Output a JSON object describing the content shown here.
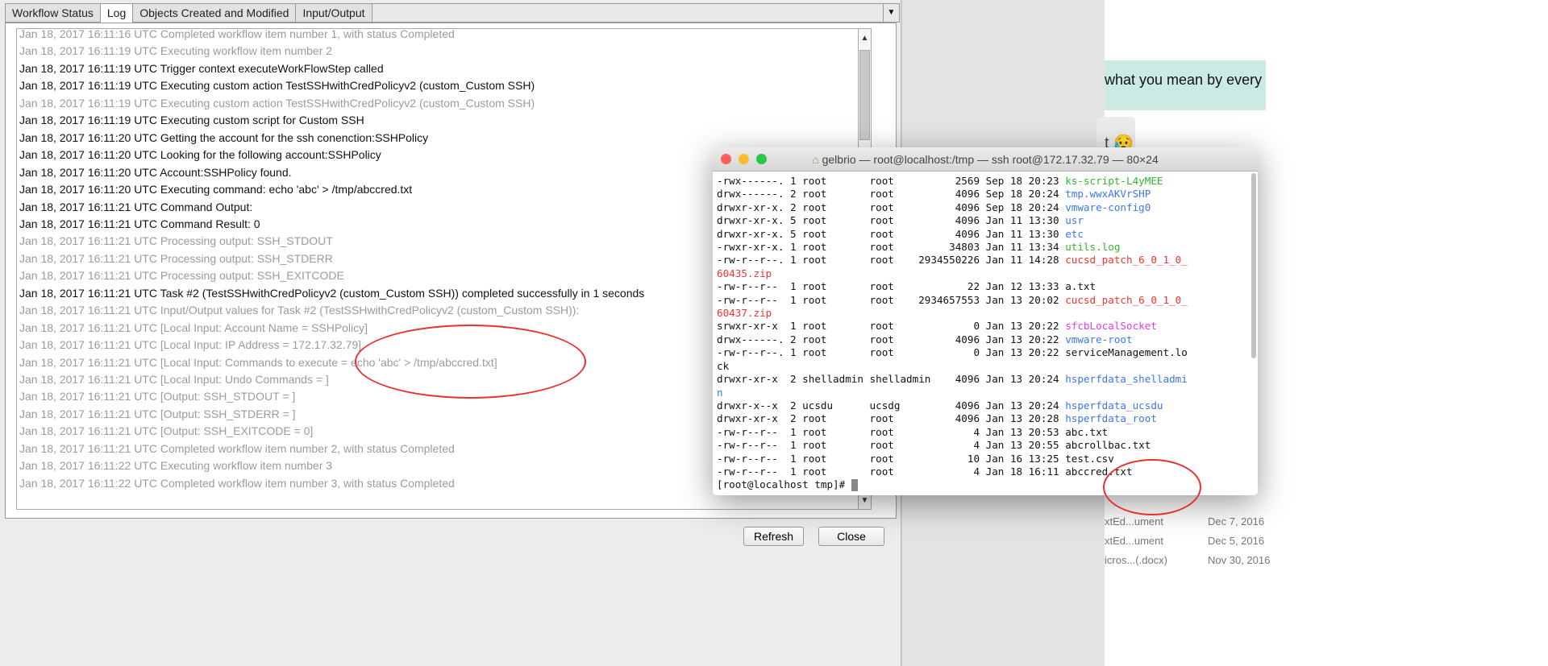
{
  "dialog": {
    "tabs": [
      {
        "label": "Workflow Status",
        "active": false
      },
      {
        "label": "Log",
        "active": true
      },
      {
        "label": "Objects Created and Modified",
        "active": false
      },
      {
        "label": "Input/Output",
        "active": false
      }
    ],
    "log": [
      {
        "text": "Jan 18, 2017 16:11:16 UTC Completed workflow item number 1, with status Completed",
        "style": "gray"
      },
      {
        "text": "Jan 18, 2017 16:11:19 UTC Executing workflow item number 2",
        "style": "gray"
      },
      {
        "text": "Jan 18, 2017 16:11:19 UTC Trigger context executeWorkFlowStep called",
        "style": "black"
      },
      {
        "text": "Jan 18, 2017 16:11:19 UTC Executing custom action TestSSHwithCredPolicyv2 (custom_Custom SSH)",
        "style": "black"
      },
      {
        "text": "Jan 18, 2017 16:11:19 UTC Executing custom action TestSSHwithCredPolicyv2 (custom_Custom SSH)",
        "style": "gray"
      },
      {
        "text": "Jan 18, 2017 16:11:19 UTC Executing custom script for Custom SSH",
        "style": "black"
      },
      {
        "text": "Jan 18, 2017 16:11:20 UTC Getting the account for the ssh conenction:SSHPolicy",
        "style": "black"
      },
      {
        "text": "Jan 18, 2017 16:11:20 UTC Looking for the following account:SSHPolicy",
        "style": "black"
      },
      {
        "text": "Jan 18, 2017 16:11:20 UTC Account:SSHPolicy found.",
        "style": "black"
      },
      {
        "text": "Jan 18, 2017 16:11:20 UTC Executing command: echo 'abc' > /tmp/abccred.txt",
        "style": "black"
      },
      {
        "text": "Jan 18, 2017 16:11:21 UTC Command Output:",
        "style": "black"
      },
      {
        "text": "Jan 18, 2017 16:11:21 UTC Command Result: 0",
        "style": "black"
      },
      {
        "text": "Jan 18, 2017 16:11:21 UTC Processing output: SSH_STDOUT",
        "style": "gray"
      },
      {
        "text": "Jan 18, 2017 16:11:21 UTC Processing output: SSH_STDERR",
        "style": "gray"
      },
      {
        "text": "Jan 18, 2017 16:11:21 UTC Processing output: SSH_EXITCODE",
        "style": "gray"
      },
      {
        "text": "Jan 18, 2017 16:11:21 UTC Task #2 (TestSSHwithCredPolicyv2 (custom_Custom SSH)) completed successfully in 1 seconds",
        "style": "black"
      },
      {
        "text": "Jan 18, 2017 16:11:21 UTC Input/Output values for Task #2 (TestSSHwithCredPolicyv2 (custom_Custom SSH)):",
        "style": "gray"
      },
      {
        "text": "Jan 18, 2017 16:11:21 UTC [Local Input: Account Name = SSHPolicy]",
        "style": "gray"
      },
      {
        "text": "Jan 18, 2017 16:11:21 UTC [Local Input: IP Address = 172.17.32.79]",
        "style": "gray"
      },
      {
        "text": "Jan 18, 2017 16:11:21 UTC [Local Input: Commands to execute = echo 'abc' > /tmp/abccred.txt]",
        "style": "gray"
      },
      {
        "text": "Jan 18, 2017 16:11:21 UTC [Local Input: Undo Commands = ]",
        "style": "gray"
      },
      {
        "text": "Jan 18, 2017 16:11:21 UTC [Output: SSH_STDOUT = ]",
        "style": "gray"
      },
      {
        "text": "Jan 18, 2017 16:11:21 UTC [Output: SSH_STDERR = ]",
        "style": "gray"
      },
      {
        "text": "Jan 18, 2017 16:11:21 UTC [Output: SSH_EXITCODE = 0]",
        "style": "gray"
      },
      {
        "text": "Jan 18, 2017 16:11:21 UTC Completed workflow item number 2, with status Completed",
        "style": "gray"
      },
      {
        "text": "Jan 18, 2017 16:11:22 UTC Executing workflow item number 3",
        "style": "gray"
      },
      {
        "text": "Jan 18, 2017 16:11:22 UTC Completed workflow item number 3, with status Completed",
        "style": "gray"
      }
    ],
    "refresh_label": "Refresh",
    "close_label": "Close"
  },
  "terminal": {
    "title": "gelbrio — root@localhost:/tmp — ssh root@172.17.32.79 — 80×24",
    "lines": [
      {
        "text": "-rwx------. 1 root       root          2569 Sep 18 20:23 ",
        "name": "ks-script-L4yMEE",
        "color": "#2fb82f"
      },
      {
        "text": "drwx------. 2 root       root          4096 Sep 18 20:24 ",
        "name": "tmp.wwxAKVrSHP",
        "color": "#3b78e7"
      },
      {
        "text": "drwxr-xr-x. 2 root       root          4096 Sep 18 20:24 ",
        "name": "vmware-config0",
        "color": "#3b78e7"
      },
      {
        "text": "drwxr-xr-x. 5 root       root          4096 Jan 11 13:30 ",
        "name": "usr",
        "color": "#3b78e7"
      },
      {
        "text": "drwxr-xr-x. 5 root       root          4096 Jan 11 13:30 ",
        "name": "etc",
        "color": "#3b78e7"
      },
      {
        "text": "-rwxr-xr-x. 1 root       root         34803 Jan 11 13:34 ",
        "name": "utils.log",
        "color": "#2fb82f"
      },
      {
        "text": "-rw-r--r--. 1 root       root    2934550226 Jan 11 14:28 ",
        "name": "cucsd_patch_6_0_1_0_",
        "color": "#f0352e"
      },
      {
        "text": "",
        "name": "60435.zip",
        "color": "#f0352e"
      },
      {
        "text": "-rw-r--r--  1 root       root            22 Jan 12 13:33 ",
        "name": "a.txt",
        "color": "#111"
      },
      {
        "text": "-rw-r--r--  1 root       root    2934657553 Jan 13 20:02 ",
        "name": "cucsd_patch_6_0_1_0_",
        "color": "#f0352e"
      },
      {
        "text": "",
        "name": "60437.zip",
        "color": "#f0352e"
      },
      {
        "text": "srwxr-xr-x  1 root       root             0 Jan 13 20:22 ",
        "name": "sfcbLocalSocket",
        "color": "#e63ce6"
      },
      {
        "text": "drwx------. 2 root       root          4096 Jan 13 20:22 ",
        "name": "vmware-root",
        "color": "#3b78e7"
      },
      {
        "text": "-rw-r--r--. 1 root       root             0 Jan 13 20:22 ",
        "name": "serviceManagement.lo",
        "color": "#111"
      },
      {
        "text": "",
        "name": "ck",
        "color": "#111"
      },
      {
        "text": "drwxr-xr-x  2 shelladmin shelladmin    4096 Jan 13 20:24 ",
        "name": "hsperfdata_shelladmi",
        "color": "#3b78e7"
      },
      {
        "text": "",
        "name": "n",
        "color": "#3b78e7"
      },
      {
        "text": "drwxr-x--x  2 ucsdu      ucsdg         4096 Jan 13 20:24 ",
        "name": "hsperfdata_ucsdu",
        "color": "#3b78e7"
      },
      {
        "text": "drwxr-xr-x  2 root       root          4096 Jan 13 20:28 ",
        "name": "hsperfdata_root",
        "color": "#3b78e7"
      },
      {
        "text": "-rw-r--r--  1 root       root             4 Jan 13 20:53 ",
        "name": "abc.txt",
        "color": "#111"
      },
      {
        "text": "-rw-r--r--  1 root       root             4 Jan 13 20:55 ",
        "name": "abcrollbac.txt",
        "color": "#111"
      },
      {
        "text": "-rw-r--r--  1 root       root            10 Jan 16 13:25 ",
        "name": "test.csv",
        "color": "#111"
      },
      {
        "text": "-rw-r--r--  1 root       root             4 Jan 18 16:11 ",
        "name": "abccred.txt",
        "color": "#111"
      }
    ],
    "prompt": "[root@localhost tmp]# "
  },
  "chat": {
    "bubble_text": "what you mean by every",
    "bubble2_text": "t 😥",
    "files": [
      {
        "name": "xtEd...ument",
        "date": "Dec 7, 2016"
      },
      {
        "name": "xtEd...ument",
        "date": "Dec 5, 2016"
      },
      {
        "name": "icros...(.docx)",
        "date": "Nov 30, 2016"
      }
    ]
  }
}
